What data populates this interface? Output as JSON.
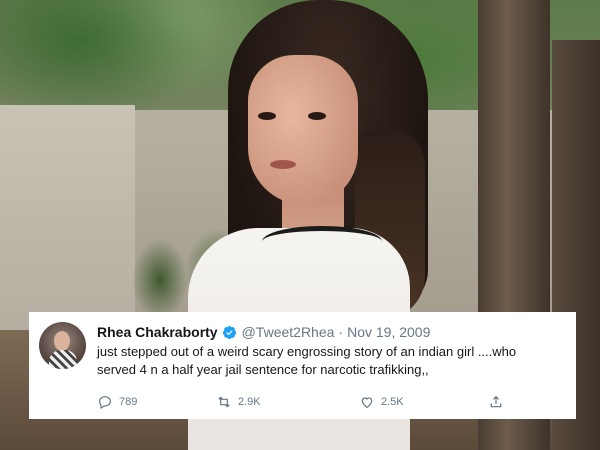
{
  "tweet": {
    "display_name": "Rhea Chakraborty",
    "verified_icon": "verified-badge-icon",
    "handle": "@Tweet2Rhea",
    "separator": "·",
    "date": "Nov 19, 2009",
    "text_lines": [
      "just stepped out of a weird scary engrossing story of an indian girl ....who",
      "served 4 n a half year jail sentence for narcotic trafikking,,"
    ],
    "actions": {
      "reply": {
        "icon": "reply-icon",
        "count": "789"
      },
      "retweet": {
        "icon": "retweet-icon",
        "count": "2.9K"
      },
      "like": {
        "icon": "heart-icon",
        "count": "2.5K"
      },
      "share": {
        "icon": "share-icon"
      }
    }
  },
  "colors": {
    "verified": "#1da1f2",
    "secondary_text": "#657786",
    "primary_text": "#14171a",
    "card_background": "#ffffff"
  }
}
